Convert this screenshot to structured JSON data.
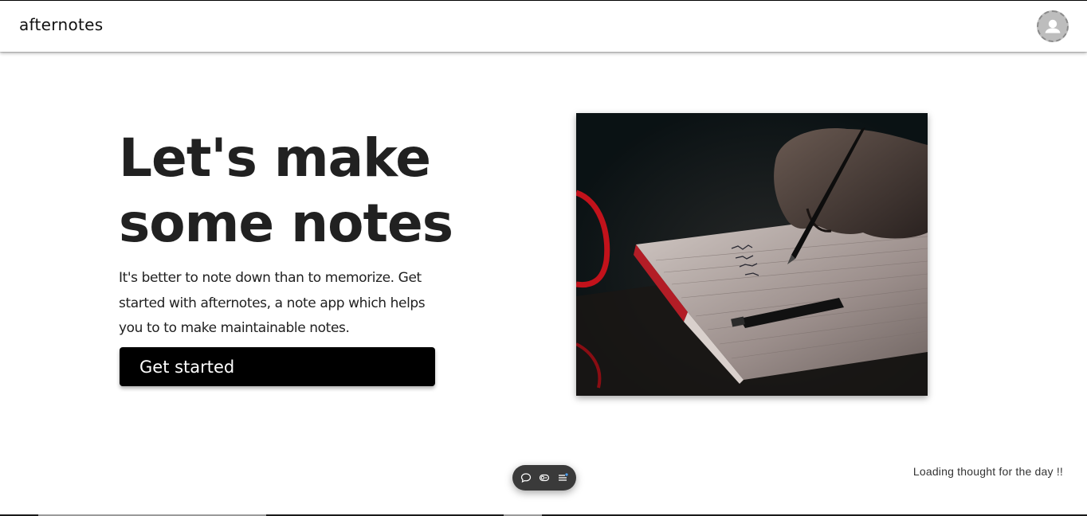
{
  "app": {
    "brand": "afternotes"
  },
  "hero": {
    "title_line1": "Let's make",
    "title_line2": "some notes",
    "subtitle": "It's better to note down than to memorize. Get started with afternotes, a note app which helps you to to make maintainable notes.",
    "cta_label": "Get started",
    "image_subject": "hand writing in a notebook with a fountain pen"
  },
  "footer": {
    "thought_text": "Loading thought for the day !!"
  },
  "floating_toolbar": {
    "items": [
      "comment-icon",
      "toggle-view-icon",
      "menu-list-icon"
    ]
  },
  "colors": {
    "cta_bg": "#000000",
    "cta_text": "#ffffff",
    "title_text": "#212121",
    "avatar_bg": "#bdbdbd",
    "toolbar_bg": "#3a3a3a"
  }
}
